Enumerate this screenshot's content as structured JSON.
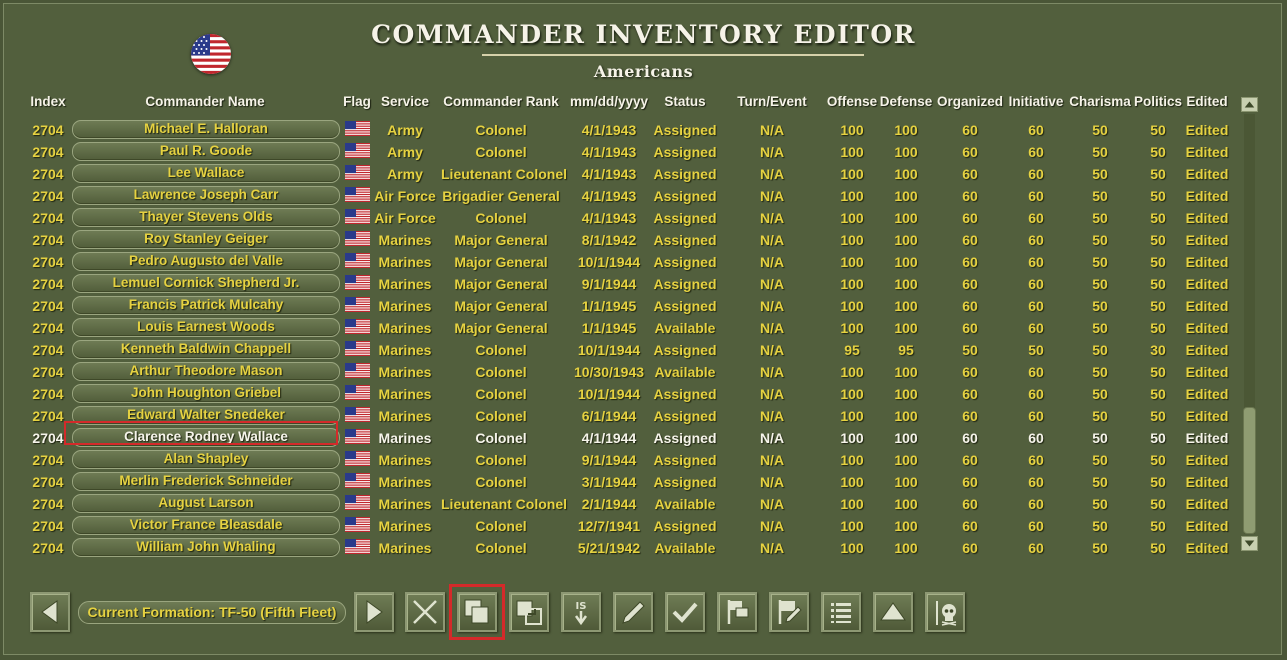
{
  "title": "COMMANDER INVENTORY EDITOR",
  "subtitle": "Americans",
  "headers": [
    "Index",
    "Commander Name",
    "Flag",
    "Service",
    "Commander Rank",
    "mm/dd/yyyy",
    "Status",
    "Turn/Event",
    "Offense",
    "Defense",
    "Organized",
    "Initiative",
    "Charisma",
    "Politics",
    "Edited"
  ],
  "rows": [
    {
      "index": "2704",
      "name": "Michael E. Halloran",
      "service": "Army",
      "rank": "Colonel",
      "date": "4/1/1943",
      "status": "Assigned",
      "turn": "N/A",
      "offense": "100",
      "defense": "100",
      "organized": "60",
      "initiative": "60",
      "charisma": "50",
      "politics": "50",
      "edited": "Edited"
    },
    {
      "index": "2704",
      "name": "Paul R. Goode",
      "service": "Army",
      "rank": "Colonel",
      "date": "4/1/1943",
      "status": "Assigned",
      "turn": "N/A",
      "offense": "100",
      "defense": "100",
      "organized": "60",
      "initiative": "60",
      "charisma": "50",
      "politics": "50",
      "edited": "Edited"
    },
    {
      "index": "2704",
      "name": "Lee Wallace",
      "service": "Army",
      "rank": "Lieutenant Colonel",
      "date": "4/1/1943",
      "status": "Assigned",
      "turn": "N/A",
      "offense": "100",
      "defense": "100",
      "organized": "60",
      "initiative": "60",
      "charisma": "50",
      "politics": "50",
      "edited": "Edited"
    },
    {
      "index": "2704",
      "name": "Lawrence Joseph Carr",
      "service": "Air Force",
      "rank": "Brigadier General",
      "date": "4/1/1943",
      "status": "Assigned",
      "turn": "N/A",
      "offense": "100",
      "defense": "100",
      "organized": "60",
      "initiative": "60",
      "charisma": "50",
      "politics": "50",
      "edited": "Edited"
    },
    {
      "index": "2704",
      "name": "Thayer Stevens Olds",
      "service": "Air Force",
      "rank": "Colonel",
      "date": "4/1/1943",
      "status": "Assigned",
      "turn": "N/A",
      "offense": "100",
      "defense": "100",
      "organized": "60",
      "initiative": "60",
      "charisma": "50",
      "politics": "50",
      "edited": "Edited"
    },
    {
      "index": "2704",
      "name": "Roy Stanley Geiger",
      "service": "Marines",
      "rank": "Major General",
      "date": "8/1/1942",
      "status": "Assigned",
      "turn": "N/A",
      "offense": "100",
      "defense": "100",
      "organized": "60",
      "initiative": "60",
      "charisma": "50",
      "politics": "50",
      "edited": "Edited"
    },
    {
      "index": "2704",
      "name": "Pedro Augusto del Valle",
      "service": "Marines",
      "rank": "Major General",
      "date": "10/1/1944",
      "status": "Assigned",
      "turn": "N/A",
      "offense": "100",
      "defense": "100",
      "organized": "60",
      "initiative": "60",
      "charisma": "50",
      "politics": "50",
      "edited": "Edited"
    },
    {
      "index": "2704",
      "name": "Lemuel Cornick Shepherd Jr.",
      "service": "Marines",
      "rank": "Major General",
      "date": "9/1/1944",
      "status": "Assigned",
      "turn": "N/A",
      "offense": "100",
      "defense": "100",
      "organized": "60",
      "initiative": "60",
      "charisma": "50",
      "politics": "50",
      "edited": "Edited"
    },
    {
      "index": "2704",
      "name": "Francis Patrick Mulcahy",
      "service": "Marines",
      "rank": "Major General",
      "date": "1/1/1945",
      "status": "Assigned",
      "turn": "N/A",
      "offense": "100",
      "defense": "100",
      "organized": "60",
      "initiative": "60",
      "charisma": "50",
      "politics": "50",
      "edited": "Edited"
    },
    {
      "index": "2704",
      "name": "Louis Earnest Woods",
      "service": "Marines",
      "rank": "Major General",
      "date": "1/1/1945",
      "status": "Available",
      "turn": "N/A",
      "offense": "100",
      "defense": "100",
      "organized": "60",
      "initiative": "60",
      "charisma": "50",
      "politics": "50",
      "edited": "Edited"
    },
    {
      "index": "2704",
      "name": "Kenneth Baldwin Chappell",
      "service": "Marines",
      "rank": "Colonel",
      "date": "10/1/1944",
      "status": "Assigned",
      "turn": "N/A",
      "offense": "95",
      "defense": "95",
      "organized": "50",
      "initiative": "50",
      "charisma": "50",
      "politics": "30",
      "edited": "Edited"
    },
    {
      "index": "2704",
      "name": "Arthur Theodore Mason",
      "service": "Marines",
      "rank": "Colonel",
      "date": "10/30/1943",
      "status": "Available",
      "turn": "N/A",
      "offense": "100",
      "defense": "100",
      "organized": "60",
      "initiative": "60",
      "charisma": "50",
      "politics": "50",
      "edited": "Edited"
    },
    {
      "index": "2704",
      "name": "John Houghton Griebel",
      "service": "Marines",
      "rank": "Colonel",
      "date": "10/1/1944",
      "status": "Assigned",
      "turn": "N/A",
      "offense": "100",
      "defense": "100",
      "organized": "60",
      "initiative": "60",
      "charisma": "50",
      "politics": "50",
      "edited": "Edited"
    },
    {
      "index": "2704",
      "name": "Edward Walter Snedeker",
      "service": "Marines",
      "rank": "Colonel",
      "date": "6/1/1944",
      "status": "Assigned",
      "turn": "N/A",
      "offense": "100",
      "defense": "100",
      "organized": "60",
      "initiative": "60",
      "charisma": "50",
      "politics": "50",
      "edited": "Edited"
    },
    {
      "index": "2704",
      "name": "Clarence Rodney Wallace",
      "service": "Marines",
      "rank": "Colonel",
      "date": "4/1/1944",
      "status": "Assigned",
      "turn": "N/A",
      "offense": "100",
      "defense": "100",
      "organized": "60",
      "initiative": "60",
      "charisma": "50",
      "politics": "50",
      "edited": "Edited",
      "selected": true
    },
    {
      "index": "2704",
      "name": "Alan Shapley",
      "service": "Marines",
      "rank": "Colonel",
      "date": "9/1/1944",
      "status": "Assigned",
      "turn": "N/A",
      "offense": "100",
      "defense": "100",
      "organized": "60",
      "initiative": "60",
      "charisma": "50",
      "politics": "50",
      "edited": "Edited"
    },
    {
      "index": "2704",
      "name": "Merlin Frederick Schneider",
      "service": "Marines",
      "rank": "Colonel",
      "date": "3/1/1944",
      "status": "Assigned",
      "turn": "N/A",
      "offense": "100",
      "defense": "100",
      "organized": "60",
      "initiative": "60",
      "charisma": "50",
      "politics": "50",
      "edited": "Edited"
    },
    {
      "index": "2704",
      "name": "August Larson",
      "service": "Marines",
      "rank": "Lieutenant Colonel",
      "date": "2/1/1944",
      "status": "Available",
      "turn": "N/A",
      "offense": "100",
      "defense": "100",
      "organized": "60",
      "initiative": "60",
      "charisma": "50",
      "politics": "50",
      "edited": "Edited"
    },
    {
      "index": "2704",
      "name": "Victor France Bleasdale",
      "service": "Marines",
      "rank": "Colonel",
      "date": "12/7/1941",
      "status": "Assigned",
      "turn": "N/A",
      "offense": "100",
      "defense": "100",
      "organized": "60",
      "initiative": "60",
      "charisma": "50",
      "politics": "50",
      "edited": "Edited"
    },
    {
      "index": "2704",
      "name": "William John Whaling",
      "service": "Marines",
      "rank": "Colonel",
      "date": "5/21/1942",
      "status": "Available",
      "turn": "N/A",
      "offense": "100",
      "defense": "100",
      "organized": "60",
      "initiative": "60",
      "charisma": "50",
      "politics": "50",
      "edited": "Edited"
    }
  ],
  "toolbar": {
    "formation_label": "Current Formation: TF-50 (Fifth Fleet)",
    "buttons": [
      {
        "name": "prev-formation-button",
        "icon": "triangle-left-icon"
      },
      {
        "name": "next-formation-button",
        "icon": "triangle-right-icon"
      },
      {
        "name": "delete-button",
        "icon": "x-icon"
      },
      {
        "name": "duplicate-button",
        "icon": "copy-squares-icon",
        "highlighted": true
      },
      {
        "name": "swap-button",
        "icon": "swap-squares-icon"
      },
      {
        "name": "is-sort-button",
        "icon": "is-down-arrow-icon"
      },
      {
        "name": "edit-pencil-button",
        "icon": "pencil-icon"
      },
      {
        "name": "confirm-button",
        "icon": "checkmark-icon"
      },
      {
        "name": "flag-button",
        "icon": "flags-icon"
      },
      {
        "name": "edit-flag-button",
        "icon": "flag-pencil-icon"
      },
      {
        "name": "list-button",
        "icon": "list-icon"
      },
      {
        "name": "move-up-button",
        "icon": "triangle-up-icon"
      },
      {
        "name": "kill-button",
        "icon": "skull-icon"
      }
    ]
  },
  "colors": {
    "background": "#525f3d",
    "text_yellow": "#e6d241",
    "text_white": "#f6f4ea",
    "highlight": "#d42a2a"
  }
}
